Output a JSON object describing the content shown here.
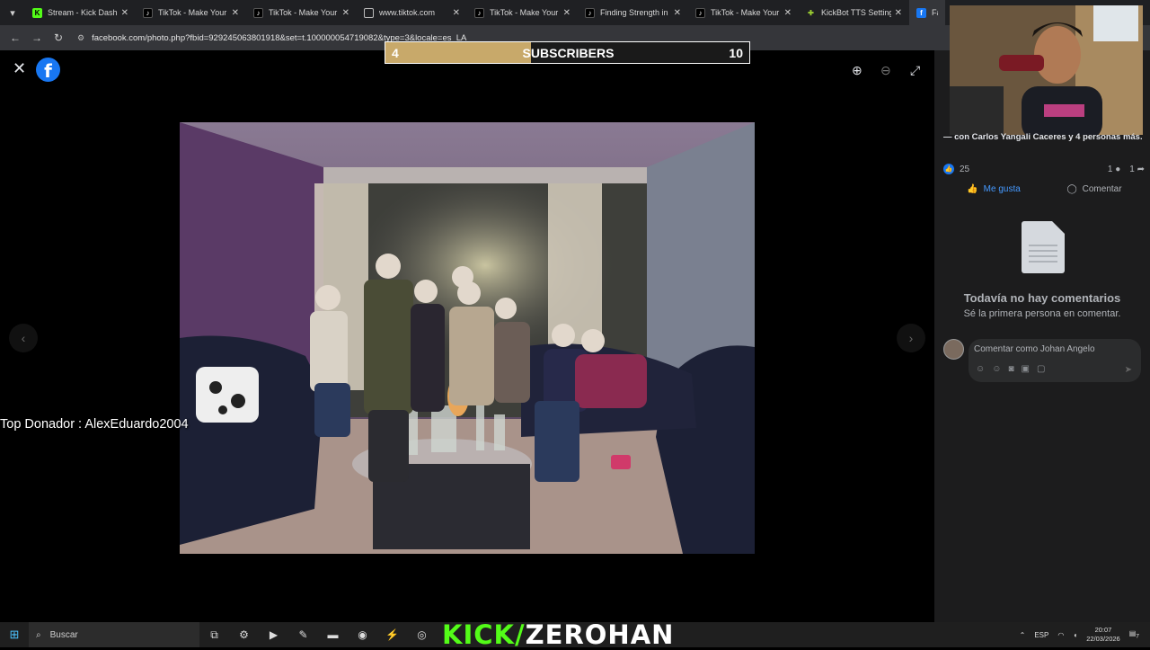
{
  "browser": {
    "tabs": [
      {
        "title": "Stream - Kick Dashbo",
        "icon": "kick-icon"
      },
      {
        "title": "TikTok - Make Your D",
        "icon": "tiktok-icon"
      },
      {
        "title": "TikTok - Make Your D",
        "icon": "tiktok-icon"
      },
      {
        "title": "www.tiktok.com",
        "icon": "globe-icon"
      },
      {
        "title": "TikTok - Make Your D",
        "icon": "tiktok-icon"
      },
      {
        "title": "Finding Strength in T",
        "icon": "tiktok-icon"
      },
      {
        "title": "TikTok - Make Your D",
        "icon": "tiktok-icon"
      },
      {
        "title": "KickBot TTS Settings",
        "icon": "kickbot-icon"
      },
      {
        "title": "Faceb",
        "icon": "facebook-icon",
        "active": true
      }
    ],
    "url": "facebook.com/photo.php?fbid=929245063801918&set=t.100000054719082&type=3&locale=es_LA"
  },
  "overlay": {
    "subs_current": "4",
    "subs_label": "SUBSCRIBERS",
    "subs_goal": "10",
    "subs_progress": 0.4,
    "top_donor": "Top Donador : AlexEduardo2004",
    "kick_prefix": "KICK/",
    "kick_channel": "ZEROHAN"
  },
  "sidebar": {
    "tagline": "— con Carlos Yangali Caceres y 4 personas más.",
    "like_count": "25",
    "comment_count": "1",
    "share_count": "1",
    "like_label": "Me gusta",
    "comment_label": "Comentar",
    "no_comments_title": "Todavía no hay comentarios",
    "no_comments_sub": "Sé la primera persona en comentar.",
    "composer_placeholder": "Comentar como Johan Angelo"
  },
  "taskbar": {
    "search_placeholder": "Buscar",
    "lang": "ESP",
    "time": "20:07",
    "date": "22/03/2026",
    "notif": "7"
  },
  "colors": {
    "facebook_blue": "#1877f2",
    "kick_green": "#53fc18",
    "sub_fill": "#c8a96a"
  }
}
